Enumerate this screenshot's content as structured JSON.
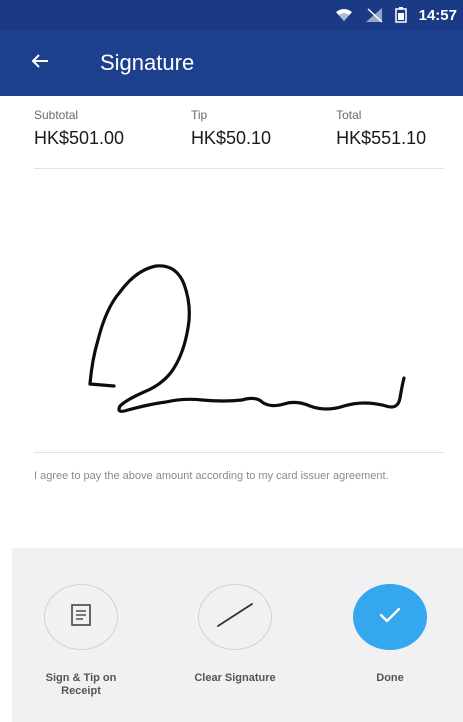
{
  "status_bar": {
    "time": "14:57",
    "icons": [
      "wifi-icon",
      "no-signal-icon",
      "battery-icon"
    ]
  },
  "app_bar": {
    "title": "Signature",
    "back_icon": "back-arrow-icon"
  },
  "amounts": {
    "subtotal": {
      "label": "Subtotal",
      "value": "HK$501.00"
    },
    "tip": {
      "label": "Tip",
      "value": "HK$50.10"
    },
    "total": {
      "label": "Total",
      "value": "HK$551.10"
    }
  },
  "agreement_text": "I agree to pay the above amount according to my card issuer agreement.",
  "actions": {
    "sign_tip_receipt": {
      "label": "Sign & Tip on Receipt",
      "icon": "receipt-icon"
    },
    "clear_signature": {
      "label": "Clear Signature",
      "icon": "slash-icon"
    },
    "done": {
      "label": "Done",
      "icon": "checkmark-icon"
    }
  },
  "colors": {
    "app_bar": "#1c3f8e",
    "status_bar": "#1a3a85",
    "done_button": "#34a7ee",
    "panel": "#f1f1f3"
  }
}
